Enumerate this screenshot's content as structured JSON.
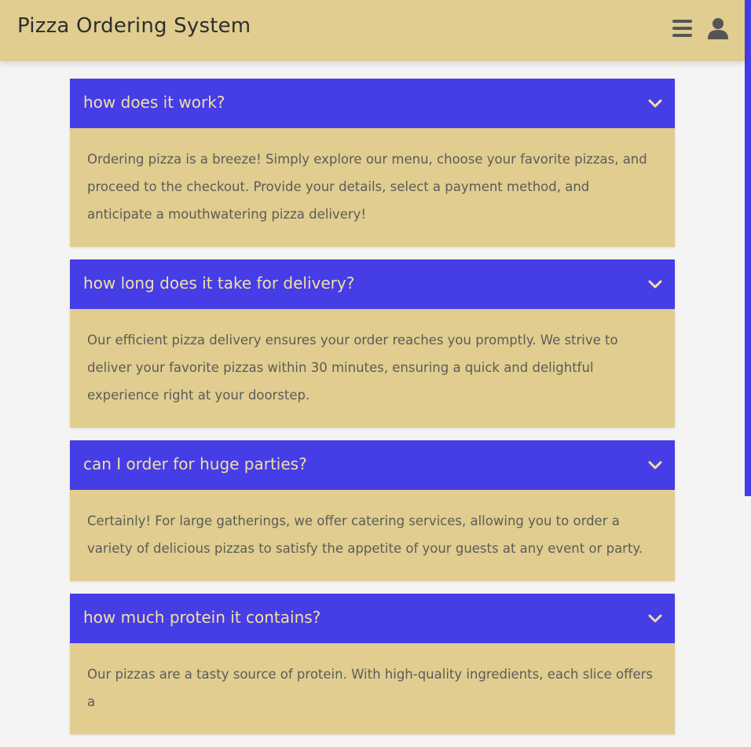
{
  "header": {
    "title": "Pizza Ordering System",
    "menu_icon": "hamburger-menu-icon",
    "user_icon": "user-icon"
  },
  "colors": {
    "header_bg": "#e0cd8f",
    "question_bg": "#453de6",
    "answer_bg": "#e0cd8f",
    "question_text": "#f1e0a4",
    "page_bg": "#f4f4f4"
  },
  "faq": [
    {
      "question": "how does it work?",
      "answer": "Ordering pizza is a breeze! Simply explore our menu, choose your favorite pizzas, and proceed to the checkout. Provide your details, select a payment method, and anticipate a mouthwatering pizza delivery!"
    },
    {
      "question": "how long does it take for delivery?",
      "answer": "Our efficient pizza delivery ensures your order reaches you promptly. We strive to deliver your favorite pizzas within 30 minutes, ensuring a quick and delightful experience right at your doorstep."
    },
    {
      "question": "can I order for huge parties?",
      "answer": "Certainly! For large gatherings, we offer catering services, allowing you to order a variety of delicious pizzas to satisfy the appetite of your guests at any event or party."
    },
    {
      "question": "how much protein it contains?",
      "answer": "Our pizzas are a tasty source of protein. With high-quality ingredients, each slice offers a"
    }
  ]
}
